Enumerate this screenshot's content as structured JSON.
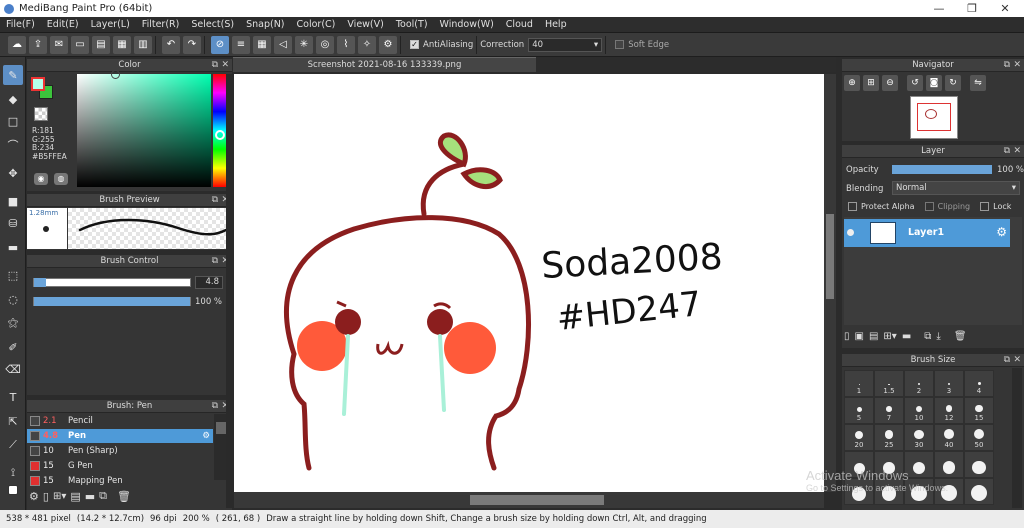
{
  "window": {
    "title": "MediBang Paint Pro (64bit)"
  },
  "menu": [
    "File(F)",
    "Edit(E)",
    "Layer(L)",
    "Filter(R)",
    "Select(S)",
    "Snap(N)",
    "Color(C)",
    "View(V)",
    "Tool(T)",
    "Window(W)",
    "Cloud",
    "Help"
  ],
  "toolbar": {
    "antialiasing_label": "AntiAliasing",
    "correction_label": "Correction",
    "correction_value": "40",
    "softedge_label": "Soft Edge"
  },
  "color_panel": {
    "title": "Color",
    "r": "R:181",
    "g": "G:255",
    "b": "B:234",
    "hex": "#B5FFEA",
    "fg_color": "#b5ffea",
    "bg_color": "#ffffff"
  },
  "brush_preview": {
    "title": "Brush Preview",
    "size": "1.28mm"
  },
  "brush_control": {
    "title": "Brush Control",
    "size_value": "4.8",
    "opacity_value": "100 %",
    "size_fraction": 0.08,
    "opacity_fraction": 1.0
  },
  "brush_list": {
    "title": "Brush: Pen",
    "items": [
      {
        "size": "2.1",
        "name": "Pencil",
        "color": "#444444",
        "selected": false
      },
      {
        "size": "4.8",
        "name": "Pen",
        "color": "#444444",
        "selected": true
      },
      {
        "size": "10",
        "name": "Pen (Sharp)",
        "color": "#444444",
        "selected": false
      },
      {
        "size": "15",
        "name": "G Pen",
        "color": "#e03030",
        "selected": false
      },
      {
        "size": "15",
        "name": "Mapping Pen",
        "color": "#e03030",
        "selected": false
      }
    ]
  },
  "document": {
    "tab_title": "Screenshot 2021-08-16 133339.png",
    "text_line1": "Soda2008",
    "text_line2": "#HD247"
  },
  "navigator": {
    "title": "Navigator"
  },
  "layer_panel": {
    "title": "Layer",
    "opacity_label": "Opacity",
    "opacity_value": "100 %",
    "blending_label": "Blending",
    "blending_value": "Normal",
    "protect_alpha": "Protect Alpha",
    "clipping": "Clipping",
    "lock": "Lock",
    "layer_name": "Layer1"
  },
  "brush_size": {
    "title": "Brush Size",
    "sizes": [
      "1",
      "1.5",
      "2",
      "3",
      "4",
      "5",
      "7",
      "10",
      "12",
      "15",
      "20",
      "25",
      "30",
      "40",
      "50"
    ]
  },
  "status": {
    "pixel": "538 * 481 pixel",
    "cm": "(14.2 * 12.7cm)",
    "dpi": "96 dpi",
    "zoom": "200 %",
    "coords": "( 261, 68 )",
    "hint": "Draw a straight line by holding down Shift, Change a brush size by holding down Ctrl, Alt, and dragging"
  },
  "watermark": {
    "line1": "Activate Windows",
    "line2": "Go to Settings to activate Windows."
  }
}
